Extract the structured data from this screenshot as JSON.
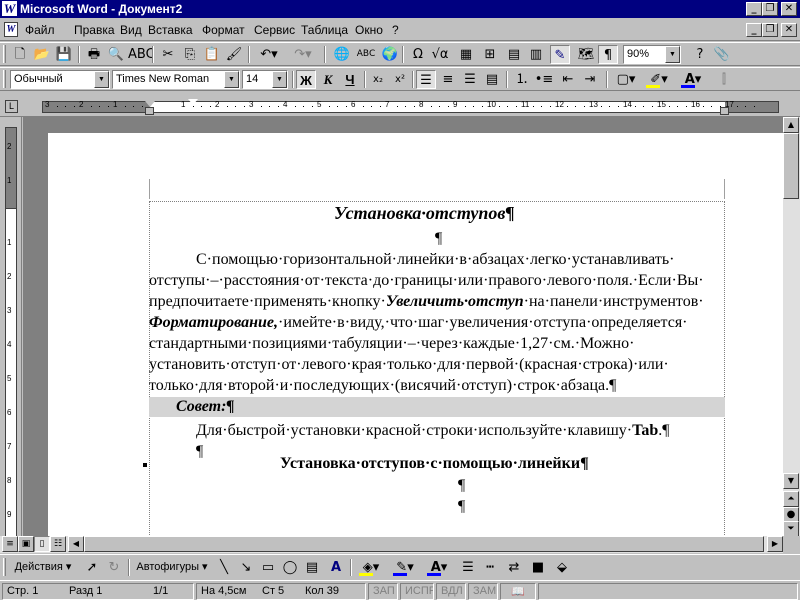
{
  "window": {
    "title": "Microsoft Word - Документ2"
  },
  "menu": [
    "Файл",
    "Правка",
    "Вид",
    "Вставка",
    "Формат",
    "Сервис",
    "Таблица",
    "Окно",
    "?"
  ],
  "toolbar_format": {
    "style": "Обычный",
    "font": "Times New Roman",
    "size": "14",
    "bold": "Ж",
    "italic": "К",
    "underline": "Ч"
  },
  "toolbar_standard": {
    "zoom": "90%"
  },
  "ruler": {
    "h_labels": [
      "3",
      "2",
      "1",
      "1",
      "2",
      "3",
      "4",
      "5",
      "6",
      "7",
      "8",
      "9",
      "10",
      "11",
      "12",
      "13",
      "14",
      "15",
      "16",
      "17"
    ],
    "v_labels": [
      "2",
      "1",
      "1",
      "2",
      "3",
      "4",
      "5",
      "6",
      "7",
      "8",
      "9",
      "10"
    ]
  },
  "document": {
    "title": "Установка·отступов¶",
    "pilcrow": "¶",
    "body_lines": [
      "С·помощью·горизонтальной·линейки·в·абзацах·легко·устанавливать·",
      "отступы·–·расстояния·от·текста·до·границы·или·правого·левого·поля.·Если·Вы·",
      "предпочитаете·применять·кнопку·",
      "Увеличить·отступ",
      "·на·панели·инструментов·",
      "Форматирование,",
      "·имейте·в·виду,·что·шаг·увеличения·отступа·определяется·",
      "стандартными·позициями·табуляции·–·через·каждые·1,27·см.·Можно·",
      "установить·отступ·от·левого·края·только·для·первой·(красная·строка)·или·",
      "только·для·второй·и·последующих·(висячий·отступ)·строк·абзаца.¶"
    ],
    "tip_label": "Совет:¶",
    "tip_text_prefix": "Для·быстрой·установки·красной·строки·используйте·клавишу·",
    "tip_key": "Tab",
    "tip_text_suffix": ".¶",
    "heading2": "Установка·отступов·с·помощью·линейки¶"
  },
  "drawing_toolbar": {
    "actions": "Действия",
    "autoshapes": "Автофигуры"
  },
  "status": {
    "page": "Стр. 1",
    "section": "Разд 1",
    "pages": "1/1",
    "at": "На 4,5см",
    "line": "Ст 5",
    "col": "Кол 39",
    "rec": "ЗАП",
    "trk": "ИСПР",
    "ext": "ВДЛ",
    "ovr": "ЗАМ"
  },
  "colors": {
    "titlebar": "#000080",
    "face": "#c0c0c0",
    "tip_shading": "#d4d4d4",
    "highlight": "#ffff00",
    "font_color": "#0000ff",
    "line_color": "#0000ff"
  }
}
